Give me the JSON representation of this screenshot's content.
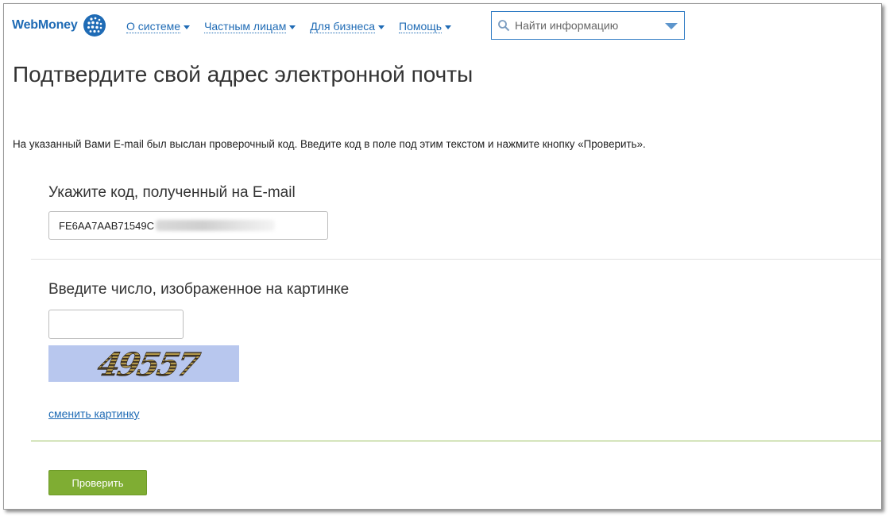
{
  "header": {
    "logo_text": "WebMoney",
    "nav": [
      {
        "label": "О системе"
      },
      {
        "label": "Частным лицам"
      },
      {
        "label": "Для бизнеса"
      },
      {
        "label": "Помощь"
      }
    ],
    "search": {
      "placeholder": "Найти информацию"
    }
  },
  "main": {
    "title": "Подтвердите свой адрес электронной почты",
    "intro": "На указанный Вами E-mail был выслан проверочный код. Введите код в поле под этим текстом и нажмите кнопку «Проверить».",
    "code_section": {
      "label": "Укажите код, полученный на E-mail",
      "value_visible": "FE6AA7AAB71549C"
    },
    "captcha_section": {
      "label": "Введите число, изображенное на картинке",
      "input_value": "",
      "captcha_text": "49557",
      "change_link": "сменить картинку"
    },
    "submit_label": "Проверить"
  },
  "colors": {
    "brand_blue": "#1f6bb5",
    "accent_green": "#7fad33",
    "captcha_bg": "#b8c7ee"
  },
  "icons": [
    "webmoney-globe-icon",
    "search-icon",
    "chevron-down-icon"
  ]
}
